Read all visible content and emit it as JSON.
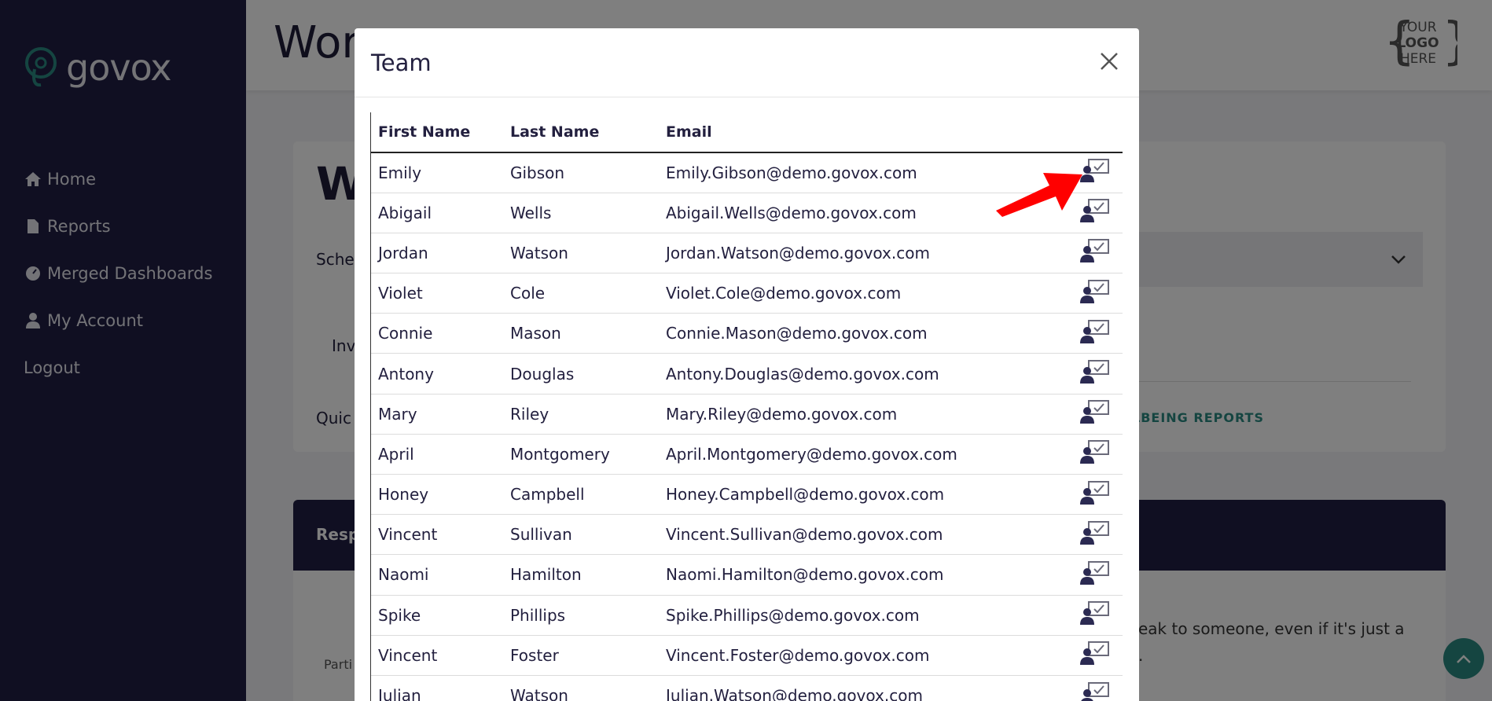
{
  "app": {
    "brand": "govox",
    "logo_text": [
      "YOUR",
      "LOGO",
      "HERE"
    ]
  },
  "sidebar": {
    "items": [
      {
        "label": "Home",
        "icon": "home-icon"
      },
      {
        "label": "Reports",
        "icon": "file-icon"
      },
      {
        "label": "Merged Dashboards",
        "icon": "dashboard-icon"
      },
      {
        "label": "My Account",
        "icon": "user-icon"
      },
      {
        "label": "Logout",
        "icon": ""
      }
    ]
  },
  "background": {
    "page_title": "Wor",
    "card_big_initial": "W",
    "schedule_label": "Sche",
    "invite_label": "Inv",
    "quick_label": "Quic",
    "wellbeing_link": "LBEING REPORTS",
    "dark_card_label": "Resp",
    "speak_text_1": "eak to someone, even if it's just a",
    "speak_text_2": ".",
    "participant_label": "Parti"
  },
  "modal": {
    "title": "Team",
    "columns": [
      "First Name",
      "Last Name",
      "Email"
    ],
    "rows": [
      {
        "first": "Emily",
        "last": "Gibson",
        "email": "Emily.Gibson@demo.govox.com"
      },
      {
        "first": "Abigail",
        "last": "Wells",
        "email": "Abigail.Wells@demo.govox.com"
      },
      {
        "first": "Jordan",
        "last": "Watson",
        "email": "Jordan.Watson@demo.govox.com"
      },
      {
        "first": "Violet",
        "last": "Cole",
        "email": "Violet.Cole@demo.govox.com"
      },
      {
        "first": "Connie",
        "last": "Mason",
        "email": "Connie.Mason@demo.govox.com"
      },
      {
        "first": "Antony",
        "last": "Douglas",
        "email": "Antony.Douglas@demo.govox.com"
      },
      {
        "first": "Mary",
        "last": "Riley",
        "email": "Mary.Riley@demo.govox.com"
      },
      {
        "first": "April",
        "last": "Montgomery",
        "email": "April.Montgomery@demo.govox.com"
      },
      {
        "first": "Honey",
        "last": "Campbell",
        "email": "Honey.Campbell@demo.govox.com"
      },
      {
        "first": "Vincent",
        "last": "Sullivan",
        "email": "Vincent.Sullivan@demo.govox.com"
      },
      {
        "first": "Naomi",
        "last": "Hamilton",
        "email": "Naomi.Hamilton@demo.govox.com"
      },
      {
        "first": "Spike",
        "last": "Phillips",
        "email": "Spike.Phillips@demo.govox.com"
      },
      {
        "first": "Vincent",
        "last": "Foster",
        "email": "Vincent.Foster@demo.govox.com"
      },
      {
        "first": "Julian",
        "last": "Watson",
        "email": "Julian.Watson@demo.govox.com"
      }
    ],
    "row_action_icon": "user-assign-icon"
  },
  "colors": {
    "sidebar_bg": "#211f45",
    "accent_teal": "#2a8b82",
    "annotation_arrow": "#ff0000"
  }
}
